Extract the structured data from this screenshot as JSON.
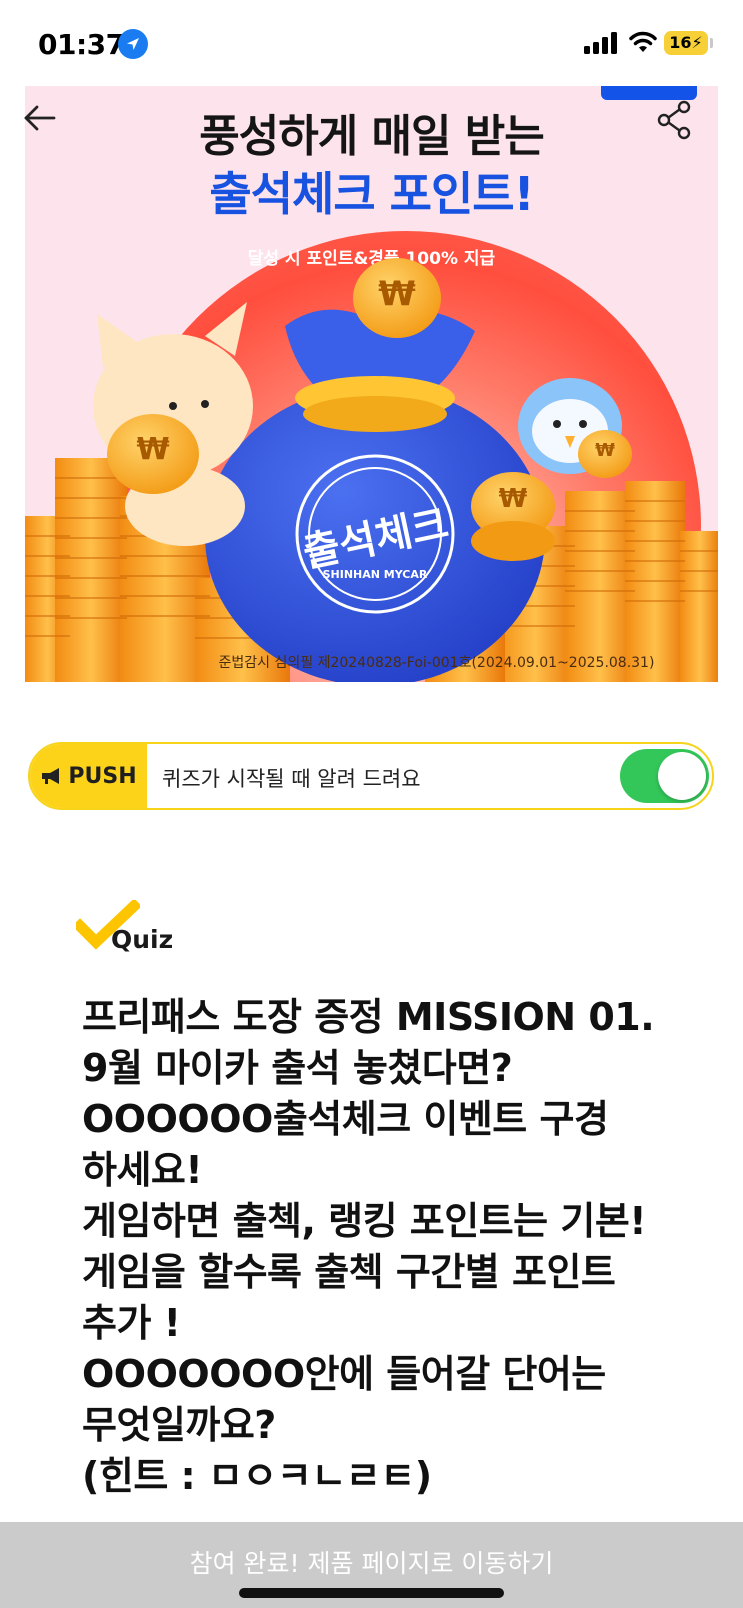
{
  "status_bar": {
    "time": "01:37",
    "battery": "16",
    "icons": [
      "location-arrow-icon",
      "signal-bars-icon",
      "wifi-icon",
      "battery-charging-icon"
    ]
  },
  "nav": {
    "back_icon": "arrow-left-icon",
    "share_icon": "share-icon"
  },
  "banner": {
    "title_line1": "풍성하게 매일 받는",
    "title_line2": "출석체크 포인트!",
    "arc_text": "달성 시 포인트&경품 100% 지급",
    "stamp_text": "출석체크",
    "stamp_brand": "SHINHAN MYCAR",
    "coin_symbol": "₩",
    "footnote": "준법감시 심의필 제20240828-Foi-001호(2024.09.01~2025.08.31)",
    "colors": {
      "background": "#fde4ec",
      "title_blue": "#1852e0",
      "accent_red": "#ff4e3e",
      "coin_gold": "#f6a623",
      "bag_blue": "#2c4fd6"
    }
  },
  "push": {
    "badge_label": "PUSH",
    "text": "퀴즈가 시작될 때 알려 드려요",
    "toggle_on": true,
    "colors": {
      "badge": "#fdd31a",
      "toggle": "#33c759"
    }
  },
  "quiz": {
    "label": "Quiz",
    "lines": [
      "프리패스 도장 증정 MISSION 01.",
      "9월 마이카 출석 놓쳤다면?",
      "OOOOOO출석체크 이벤트 구경",
      "하세요!",
      "게임하면 출첵, 랭킹 포인트는 기본!",
      "게임을 할수록  출첵 구간별 포인트",
      "추가 !",
      "OOOOOOO안에 들어갈 단어는",
      "무엇일까요?",
      "(힌트 : ㅁㅇㅋㄴㄹㅌ)"
    ]
  },
  "bottom": {
    "button_label": "참여 완료! 제품 페이지로 이동하기"
  }
}
